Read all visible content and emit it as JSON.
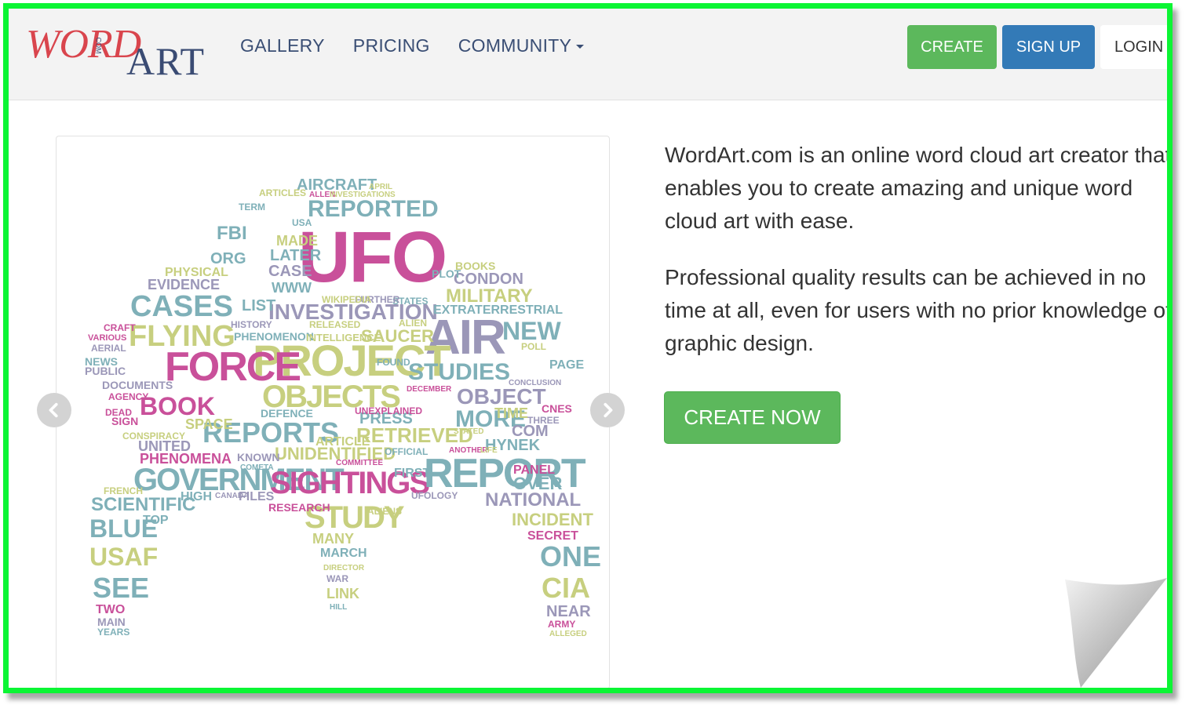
{
  "logo": {
    "word": "WORD",
    "com": "COM",
    "art": "ART"
  },
  "nav": {
    "links": [
      "GALLERY",
      "PRICING",
      "COMMUNITY"
    ],
    "create_label": "CREATE",
    "signup_label": "SIGN UP",
    "login_label": "LOGIN"
  },
  "hero": {
    "paragraph_1": "WordArt.com is an online word cloud art creator that enables you to create amazing and unique word cloud art with ease.",
    "paragraph_2": "Professional quality results can be achieved in no time at all, even for users with no prior knowledge of graphic design.",
    "cta_label": "CREATE NOW"
  },
  "carousel": {
    "prev_icon": "chevron-left-icon",
    "next_icon": "chevron-right-icon",
    "word_cloud": [
      {
        "t": "UFO",
        "c": "#c9509a"
      },
      {
        "t": "AIR",
        "c": "#9b97b8"
      },
      {
        "t": "PROJECT",
        "c": "#c7cf7f"
      },
      {
        "t": "FORCE",
        "c": "#c9509a"
      },
      {
        "t": "OBJECTS",
        "c": "#c7cf7f"
      },
      {
        "t": "REPORTED",
        "c": "#7fb0b8"
      },
      {
        "t": "AIRCRAFT",
        "c": "#7fb0b8"
      },
      {
        "t": "INVESTIGATION",
        "c": "#9b97b8"
      },
      {
        "t": "CASES",
        "c": "#7fb0b8"
      },
      {
        "t": "FLYING",
        "c": "#c7cf7f"
      },
      {
        "t": "BOOK",
        "c": "#c9509a"
      },
      {
        "t": "REPORTS",
        "c": "#7fb0b8"
      },
      {
        "t": "GOVERNMENT",
        "c": "#7fb0b8"
      },
      {
        "t": "SIGHTINGS",
        "c": "#c9509a"
      },
      {
        "t": "REPORT",
        "c": "#7fb0b8"
      },
      {
        "t": "STUDIES",
        "c": "#7fb0b8"
      },
      {
        "t": "OBJECT",
        "c": "#9b97b8"
      },
      {
        "t": "RETRIEVED",
        "c": "#c7cf7f"
      },
      {
        "t": "UNIDENTIFIED",
        "c": "#c7cf7f"
      },
      {
        "t": "MILITARY",
        "c": "#c7cf7f"
      },
      {
        "t": "CONDON",
        "c": "#9b97b8"
      },
      {
        "t": "EXTRATERRESTRIAL",
        "c": "#7fb0b8"
      },
      {
        "t": "NEW",
        "c": "#7fb0b8"
      },
      {
        "t": "SAUCER",
        "c": "#c7cf7f"
      },
      {
        "t": "PHENOMENON",
        "c": "#7fb0b8"
      },
      {
        "t": "STUDY",
        "c": "#c7cf7f"
      },
      {
        "t": "SCIENTIFIC",
        "c": "#7fb0b8"
      },
      {
        "t": "BLUE",
        "c": "#7fb0b8"
      },
      {
        "t": "USAF",
        "c": "#c7cf7f"
      },
      {
        "t": "SEE",
        "c": "#7fb0b8"
      },
      {
        "t": "TWO",
        "c": "#c9509a"
      },
      {
        "t": "NATIONAL",
        "c": "#9b97b8"
      },
      {
        "t": "INCIDENT",
        "c": "#c7cf7f"
      },
      {
        "t": "SECRET",
        "c": "#c9509a"
      },
      {
        "t": "ONE",
        "c": "#7fb0b8"
      },
      {
        "t": "CIA",
        "c": "#c7cf7f"
      },
      {
        "t": "NEAR",
        "c": "#9b97b8"
      },
      {
        "t": "MORE",
        "c": "#7fb0b8"
      },
      {
        "t": "PRESS",
        "c": "#7fb0b8"
      },
      {
        "t": "COM",
        "c": "#9b97b8"
      },
      {
        "t": "HYNEK",
        "c": "#7fb0b8"
      },
      {
        "t": "MANY",
        "c": "#c7cf7f"
      },
      {
        "t": "MARCH",
        "c": "#7fb0b8"
      },
      {
        "t": "PHENOMENA",
        "c": "#c9509a"
      },
      {
        "t": "UNITED",
        "c": "#9b97b8"
      },
      {
        "t": "SPACE",
        "c": "#c7cf7f"
      },
      {
        "t": "DOCUMENTS",
        "c": "#9b97b8"
      },
      {
        "t": "EVIDENCE",
        "c": "#9b97b8"
      },
      {
        "t": "PHYSICAL",
        "c": "#c7cf7f"
      },
      {
        "t": "FBI",
        "c": "#7fb0b8"
      },
      {
        "t": "ORG",
        "c": "#7fb0b8"
      },
      {
        "t": "LATER",
        "c": "#7fb0b8"
      },
      {
        "t": "CASE",
        "c": "#9b97b8"
      },
      {
        "t": "MADE",
        "c": "#c7cf7f"
      },
      {
        "t": "WWW",
        "c": "#7fb0b8"
      },
      {
        "t": "LIST",
        "c": "#7fb0b8"
      },
      {
        "t": "ARTICLES",
        "c": "#c7cf7f"
      },
      {
        "t": "TERM",
        "c": "#7fb0b8"
      },
      {
        "t": "PANEL",
        "c": "#c9509a"
      },
      {
        "t": "OVER",
        "c": "#7fb0b8"
      },
      {
        "t": "FILES",
        "c": "#9b97b8"
      },
      {
        "t": "HIGH",
        "c": "#7fb0b8"
      },
      {
        "t": "TOP",
        "c": "#7fb0b8"
      },
      {
        "t": "DEFENCE",
        "c": "#7fb0b8"
      },
      {
        "t": "UNEXPLAINED",
        "c": "#c9509a"
      },
      {
        "t": "TIME",
        "c": "#c7cf7f"
      },
      {
        "t": "CNES",
        "c": "#c9509a"
      },
      {
        "t": "THREE",
        "c": "#9b97b8"
      },
      {
        "t": "PAGE",
        "c": "#7fb0b8"
      },
      {
        "t": "BOOKS",
        "c": "#c7cf7f"
      },
      {
        "t": "PLOT",
        "c": "#7fb0b8"
      },
      {
        "t": "NEWS",
        "c": "#7fb0b8"
      },
      {
        "t": "PUBLIC",
        "c": "#9b97b8"
      },
      {
        "t": "AERIAL",
        "c": "#9b97b8"
      },
      {
        "t": "CRAFT",
        "c": "#c9509a"
      },
      {
        "t": "AGENCY",
        "c": "#c9509a"
      },
      {
        "t": "SIGN",
        "c": "#c9509a"
      },
      {
        "t": "DEAD",
        "c": "#c9509a"
      },
      {
        "t": "RESEARCH",
        "c": "#c9509a"
      },
      {
        "t": "FIRST",
        "c": "#7fb0b8"
      },
      {
        "t": "UFOLOGY",
        "c": "#9b97b8"
      },
      {
        "t": "ALIENS",
        "c": "#c7cf7f"
      },
      {
        "t": "WAR",
        "c": "#9b97b8"
      },
      {
        "t": "LINK",
        "c": "#c7cf7f"
      },
      {
        "t": "MAIN",
        "c": "#9b97b8"
      },
      {
        "t": "YEARS",
        "c": "#7fb0b8"
      },
      {
        "t": "ARMY",
        "c": "#c9509a"
      },
      {
        "t": "KNOWN",
        "c": "#9b97b8"
      },
      {
        "t": "ARTICLE",
        "c": "#c7cf7f"
      },
      {
        "t": "INTELLIGENCE",
        "c": "#c7cf7f"
      },
      {
        "t": "RELEASED",
        "c": "#c7cf7f"
      },
      {
        "t": "HISTORY",
        "c": "#9b97b8"
      },
      {
        "t": "CONSPIRACY",
        "c": "#c7cf7f"
      },
      {
        "t": "FRENCH",
        "c": "#c7cf7f"
      },
      {
        "t": "FOUND",
        "c": "#7fb0b8"
      },
      {
        "t": "STATES",
        "c": "#7fb0b8"
      },
      {
        "t": "FURTHER",
        "c": "#9b97b8"
      },
      {
        "t": "WIKIPEDIA",
        "c": "#c7cf7f"
      },
      {
        "t": "ALIEN",
        "c": "#c7cf7f"
      },
      {
        "t": "CONCLUSION",
        "c": "#9b97b8"
      },
      {
        "t": "POLL",
        "c": "#c7cf7f"
      },
      {
        "t": "STATED",
        "c": "#c7cf7f"
      },
      {
        "t": "ANOTHER",
        "c": "#c9509a"
      },
      {
        "t": "COMMITTEE",
        "c": "#c9509a"
      },
      {
        "t": "CANADA",
        "c": "#9b97b8"
      },
      {
        "t": "COMETA",
        "c": "#7fb0b8"
      },
      {
        "t": "DIRECTOR",
        "c": "#c7cf7f"
      },
      {
        "t": "HILL",
        "c": "#7fb0b8"
      },
      {
        "t": "OFFICIAL",
        "c": "#7fb0b8"
      },
      {
        "t": "USA",
        "c": "#7fb0b8"
      },
      {
        "t": "APRIL",
        "c": "#c7cf7f"
      },
      {
        "t": "ALLEN",
        "c": "#c9509a"
      },
      {
        "t": "INVESTIGATIONS",
        "c": "#c7cf7f"
      },
      {
        "t": "ALLEGED",
        "c": "#c7cf7f"
      },
      {
        "t": "LIFE",
        "c": "#c7cf7f"
      },
      {
        "t": "DECEMBER",
        "c": "#c9509a"
      },
      {
        "t": "VARIOUS",
        "c": "#c9509a"
      }
    ]
  }
}
